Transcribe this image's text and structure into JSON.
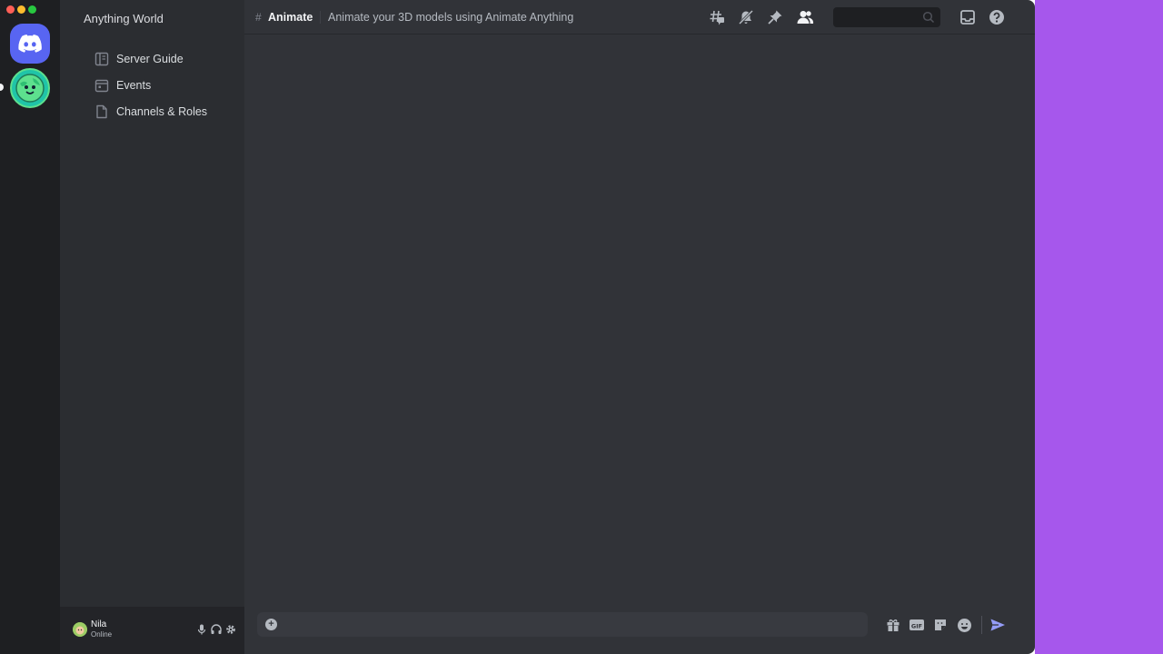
{
  "server": {
    "name": "Anything World"
  },
  "sidebar": {
    "items": [
      {
        "label": "Server Guide",
        "icon": "book-icon"
      },
      {
        "label": "Events",
        "icon": "calendar-icon"
      },
      {
        "label": "Channels & Roles",
        "icon": "document-icon"
      }
    ]
  },
  "header": {
    "hash": "#",
    "channel": "Animate",
    "topic": "Animate your 3D models using Animate Anything",
    "icons": [
      "threads-icon",
      "mute-bell-icon",
      "pin-icon",
      "members-icon",
      "inbox-icon",
      "help-icon"
    ],
    "search_placeholder": ""
  },
  "user": {
    "name": "Nila",
    "status": "Online"
  },
  "composer": {
    "placeholder": "",
    "icons": [
      "gift-icon",
      "gif-icon",
      "sticker-icon",
      "emoji-icon",
      "send-icon"
    ]
  },
  "colors": {
    "accent": "#5865f2",
    "backdrop": "#a657ec",
    "send": "#949cf7"
  }
}
